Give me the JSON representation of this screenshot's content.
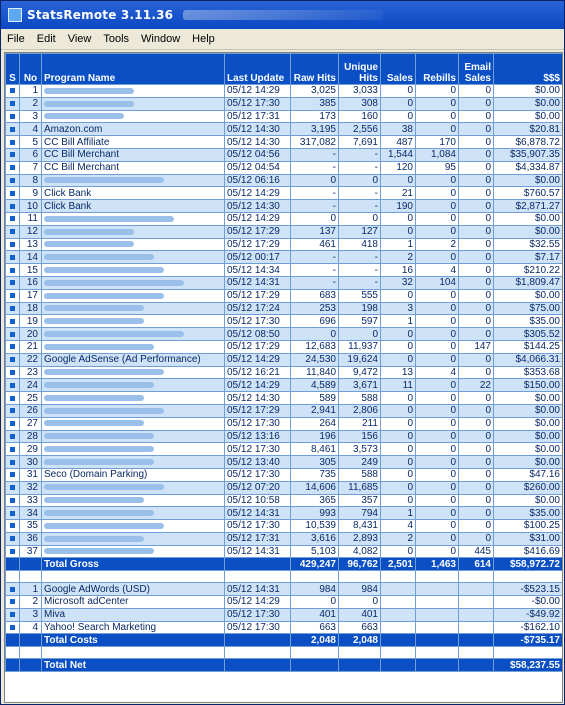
{
  "window": {
    "title": "StatsRemote 3.11.36"
  },
  "menu": [
    "File",
    "Edit",
    "View",
    "Tools",
    "Window",
    "Help"
  ],
  "columns": {
    "s": "S",
    "no": "No",
    "program": "Program Name",
    "update": "Last Update",
    "raw": "Raw Hits",
    "unique": "Unique Hits",
    "sales": "Sales",
    "rebills": "Rebills",
    "email": "Email Sales",
    "money": "$$$"
  },
  "colors": {
    "accent": "#0a4fc4",
    "stripe": "#cfe3f8",
    "text": "#0a2a66"
  },
  "rows": [
    {
      "no": "1",
      "name": "",
      "blur": 90,
      "date": "05/12",
      "time": "14:29",
      "raw": "3,025",
      "uniq": "3,033",
      "sales": "0",
      "rebills": "0",
      "email": "0",
      "money": "$0.00"
    },
    {
      "no": "2",
      "name": "",
      "blur": 90,
      "date": "05/12",
      "time": "17:30",
      "raw": "385",
      "uniq": "308",
      "sales": "0",
      "rebills": "0",
      "email": "0",
      "money": "$0.00"
    },
    {
      "no": "3",
      "name": "",
      "blur": 80,
      "date": "05/12",
      "time": "17:31",
      "raw": "173",
      "uniq": "160",
      "sales": "0",
      "rebills": "0",
      "email": "0",
      "money": "$0.00"
    },
    {
      "no": "4",
      "name": "Amazon.com",
      "blur": 0,
      "date": "05/12",
      "time": "14:30",
      "raw": "3,195",
      "uniq": "2,556",
      "sales": "38",
      "rebills": "0",
      "email": "0",
      "money": "$20.81"
    },
    {
      "no": "5",
      "name": "CC Bill Affiliate",
      "blur": 0,
      "date": "05/12",
      "time": "14:30",
      "raw": "317,082",
      "uniq": "7,691",
      "sales": "487",
      "rebills": "170",
      "email": "0",
      "money": "$6,878.72"
    },
    {
      "no": "6",
      "name": "CC Bill Merchant",
      "blur": 0,
      "date": "05/12",
      "time": "04:56",
      "raw": "-",
      "uniq": "-",
      "sales": "1,544",
      "rebills": "1,084",
      "email": "0",
      "money": "$35,907.35"
    },
    {
      "no": "7",
      "name": "CC Bill Merchant",
      "blur": 0,
      "date": "05/12",
      "time": "04:54",
      "raw": "-",
      "uniq": "-",
      "sales": "120",
      "rebills": "95",
      "email": "0",
      "money": "$4,334.87"
    },
    {
      "no": "8",
      "name": "",
      "blur": 120,
      "date": "05/12",
      "time": "06:16",
      "raw": "0",
      "uniq": "0",
      "sales": "0",
      "rebills": "0",
      "email": "0",
      "money": "$0.00"
    },
    {
      "no": "9",
      "name": "Click Bank",
      "blur": 0,
      "date": "05/12",
      "time": "14:29",
      "raw": "-",
      "uniq": "-",
      "sales": "21",
      "rebills": "0",
      "email": "0",
      "money": "$760.57"
    },
    {
      "no": "10",
      "name": "Click Bank",
      "blur": 0,
      "date": "05/12",
      "time": "14:30",
      "raw": "-",
      "uniq": "-",
      "sales": "190",
      "rebills": "0",
      "email": "0",
      "money": "$2,871.27"
    },
    {
      "no": "11",
      "name": "",
      "blur": 130,
      "date": "05/12",
      "time": "14:29",
      "raw": "0",
      "uniq": "0",
      "sales": "0",
      "rebills": "0",
      "email": "0",
      "money": "$0.00"
    },
    {
      "no": "12",
      "name": "",
      "blur": 90,
      "date": "05/12",
      "time": "17:29",
      "raw": "137",
      "uniq": "127",
      "sales": "0",
      "rebills": "0",
      "email": "0",
      "money": "$0.00"
    },
    {
      "no": "13",
      "name": "",
      "blur": 90,
      "date": "05/12",
      "time": "17:29",
      "raw": "461",
      "uniq": "418",
      "sales": "1",
      "rebills": "2",
      "email": "0",
      "money": "$32.55"
    },
    {
      "no": "14",
      "name": "",
      "blur": 110,
      "date": "05/12",
      "time": "00:17",
      "raw": "-",
      "uniq": "-",
      "sales": "2",
      "rebills": "0",
      "email": "0",
      "money": "$7.17"
    },
    {
      "no": "15",
      "name": "",
      "blur": 120,
      "date": "05/12",
      "time": "14:34",
      "raw": "-",
      "uniq": "-",
      "sales": "16",
      "rebills": "4",
      "email": "0",
      "money": "$210.22"
    },
    {
      "no": "16",
      "name": "",
      "blur": 140,
      "date": "05/12",
      "time": "14:31",
      "raw": "-",
      "uniq": "-",
      "sales": "32",
      "rebills": "104",
      "email": "0",
      "money": "$1,809.47"
    },
    {
      "no": "17",
      "name": "",
      "blur": 120,
      "date": "05/12",
      "time": "17:29",
      "raw": "683",
      "uniq": "555",
      "sales": "0",
      "rebills": "0",
      "email": "0",
      "money": "$0.00"
    },
    {
      "no": "18",
      "name": "",
      "blur": 100,
      "date": "05/12",
      "time": "17:24",
      "raw": "253",
      "uniq": "198",
      "sales": "3",
      "rebills": "0",
      "email": "0",
      "money": "$75.00"
    },
    {
      "no": "19",
      "name": "",
      "blur": 100,
      "date": "05/12",
      "time": "17:30",
      "raw": "696",
      "uniq": "597",
      "sales": "1",
      "rebills": "0",
      "email": "0",
      "money": "$35.00"
    },
    {
      "no": "20",
      "name": "",
      "blur": 140,
      "date": "05/12",
      "time": "08:50",
      "raw": "0",
      "uniq": "0",
      "sales": "0",
      "rebills": "0",
      "email": "0",
      "money": "$305.52"
    },
    {
      "no": "21",
      "name": "",
      "blur": 110,
      "date": "05/12",
      "time": "17:29",
      "raw": "12,683",
      "uniq": "11,937",
      "sales": "0",
      "rebills": "0",
      "email": "147",
      "money": "$144.25"
    },
    {
      "no": "22",
      "name": "Google AdSense (Ad Performance)",
      "blur": 0,
      "date": "05/12",
      "time": "14:29",
      "raw": "24,530",
      "uniq": "19,624",
      "sales": "0",
      "rebills": "0",
      "email": "0",
      "money": "$4,066.31"
    },
    {
      "no": "23",
      "name": "",
      "blur": 120,
      "date": "05/12",
      "time": "16:21",
      "raw": "11,840",
      "uniq": "9,472",
      "sales": "13",
      "rebills": "4",
      "email": "0",
      "money": "$353.68"
    },
    {
      "no": "24",
      "name": "",
      "blur": 110,
      "date": "05/12",
      "time": "14:29",
      "raw": "4,589",
      "uniq": "3,671",
      "sales": "11",
      "rebills": "0",
      "email": "22",
      "money": "$150.00"
    },
    {
      "no": "25",
      "name": "",
      "blur": 100,
      "date": "05/12",
      "time": "14:30",
      "raw": "589",
      "uniq": "588",
      "sales": "0",
      "rebills": "0",
      "email": "0",
      "money": "$0.00"
    },
    {
      "no": "26",
      "name": "",
      "blur": 120,
      "date": "05/12",
      "time": "17:29",
      "raw": "2,941",
      "uniq": "2,806",
      "sales": "0",
      "rebills": "0",
      "email": "0",
      "money": "$0.00"
    },
    {
      "no": "27",
      "name": "",
      "blur": 100,
      "date": "05/12",
      "time": "17:30",
      "raw": "264",
      "uniq": "211",
      "sales": "0",
      "rebills": "0",
      "email": "0",
      "money": "$0.00"
    },
    {
      "no": "28",
      "name": "",
      "blur": 110,
      "date": "05/12",
      "time": "13:16",
      "raw": "196",
      "uniq": "156",
      "sales": "0",
      "rebills": "0",
      "email": "0",
      "money": "$0.00"
    },
    {
      "no": "29",
      "name": "",
      "blur": 110,
      "date": "05/12",
      "time": "17:30",
      "raw": "8,461",
      "uniq": "3,573",
      "sales": "0",
      "rebills": "0",
      "email": "0",
      "money": "$0.00"
    },
    {
      "no": "30",
      "name": "",
      "blur": 110,
      "date": "05/12",
      "time": "13:40",
      "raw": "305",
      "uniq": "249",
      "sales": "0",
      "rebills": "0",
      "email": "0",
      "money": "$0.00"
    },
    {
      "no": "31",
      "name": "Seco (Domain Parking)",
      "blur": 0,
      "date": "05/12",
      "time": "17:30",
      "raw": "735",
      "uniq": "588",
      "sales": "0",
      "rebills": "0",
      "email": "0",
      "money": "$47.16"
    },
    {
      "no": "32",
      "name": "",
      "blur": 120,
      "date": "05/12",
      "time": "07:20",
      "raw": "14,606",
      "uniq": "11,685",
      "sales": "0",
      "rebills": "0",
      "email": "0",
      "money": "$260.00"
    },
    {
      "no": "33",
      "name": "",
      "blur": 100,
      "date": "05/12",
      "time": "10:58",
      "raw": "365",
      "uniq": "357",
      "sales": "0",
      "rebills": "0",
      "email": "0",
      "money": "$0.00"
    },
    {
      "no": "34",
      "name": "",
      "blur": 110,
      "date": "05/12",
      "time": "14:31",
      "raw": "993",
      "uniq": "794",
      "sales": "1",
      "rebills": "0",
      "email": "0",
      "money": "$35.00"
    },
    {
      "no": "35",
      "name": "",
      "blur": 120,
      "date": "05/12",
      "time": "17:30",
      "raw": "10,539",
      "uniq": "8,431",
      "sales": "4",
      "rebills": "0",
      "email": "0",
      "money": "$100.25"
    },
    {
      "no": "36",
      "name": "",
      "blur": 100,
      "date": "05/12",
      "time": "17:31",
      "raw": "3,616",
      "uniq": "2,893",
      "sales": "2",
      "rebills": "0",
      "email": "0",
      "money": "$31.00"
    },
    {
      "no": "37",
      "name": "",
      "blur": 110,
      "date": "05/12",
      "time": "14:31",
      "raw": "5,103",
      "uniq": "4,082",
      "sales": "0",
      "rebills": "0",
      "email": "445",
      "money": "$416.69"
    }
  ],
  "gross": {
    "label": "Total Gross",
    "raw": "429,247",
    "uniq": "96,762",
    "sales": "2,501",
    "rebills": "1,463",
    "email": "614",
    "money": "$58,972.72"
  },
  "costs": [
    {
      "no": "1",
      "name": "Google AdWords (USD)",
      "date": "05/12",
      "time": "14:31",
      "raw": "984",
      "uniq": "984",
      "money": "-$523.15"
    },
    {
      "no": "2",
      "name": "Microsoft adCenter",
      "date": "05/12",
      "time": "14:29",
      "raw": "0",
      "uniq": "0",
      "money": "-$0.00"
    },
    {
      "no": "3",
      "name": "Miva",
      "date": "05/12",
      "time": "17:30",
      "raw": "401",
      "uniq": "401",
      "money": "-$49.92"
    },
    {
      "no": "4",
      "name": "Yahoo! Search Marketing",
      "date": "05/12",
      "time": "17:30",
      "raw": "663",
      "uniq": "663",
      "money": "-$162.10"
    }
  ],
  "total_costs": {
    "label": "Total Costs",
    "raw": "2,048",
    "uniq": "2,048",
    "money": "-$735.17"
  },
  "total_net": {
    "label": "Total Net",
    "money": "$58,237.55"
  }
}
